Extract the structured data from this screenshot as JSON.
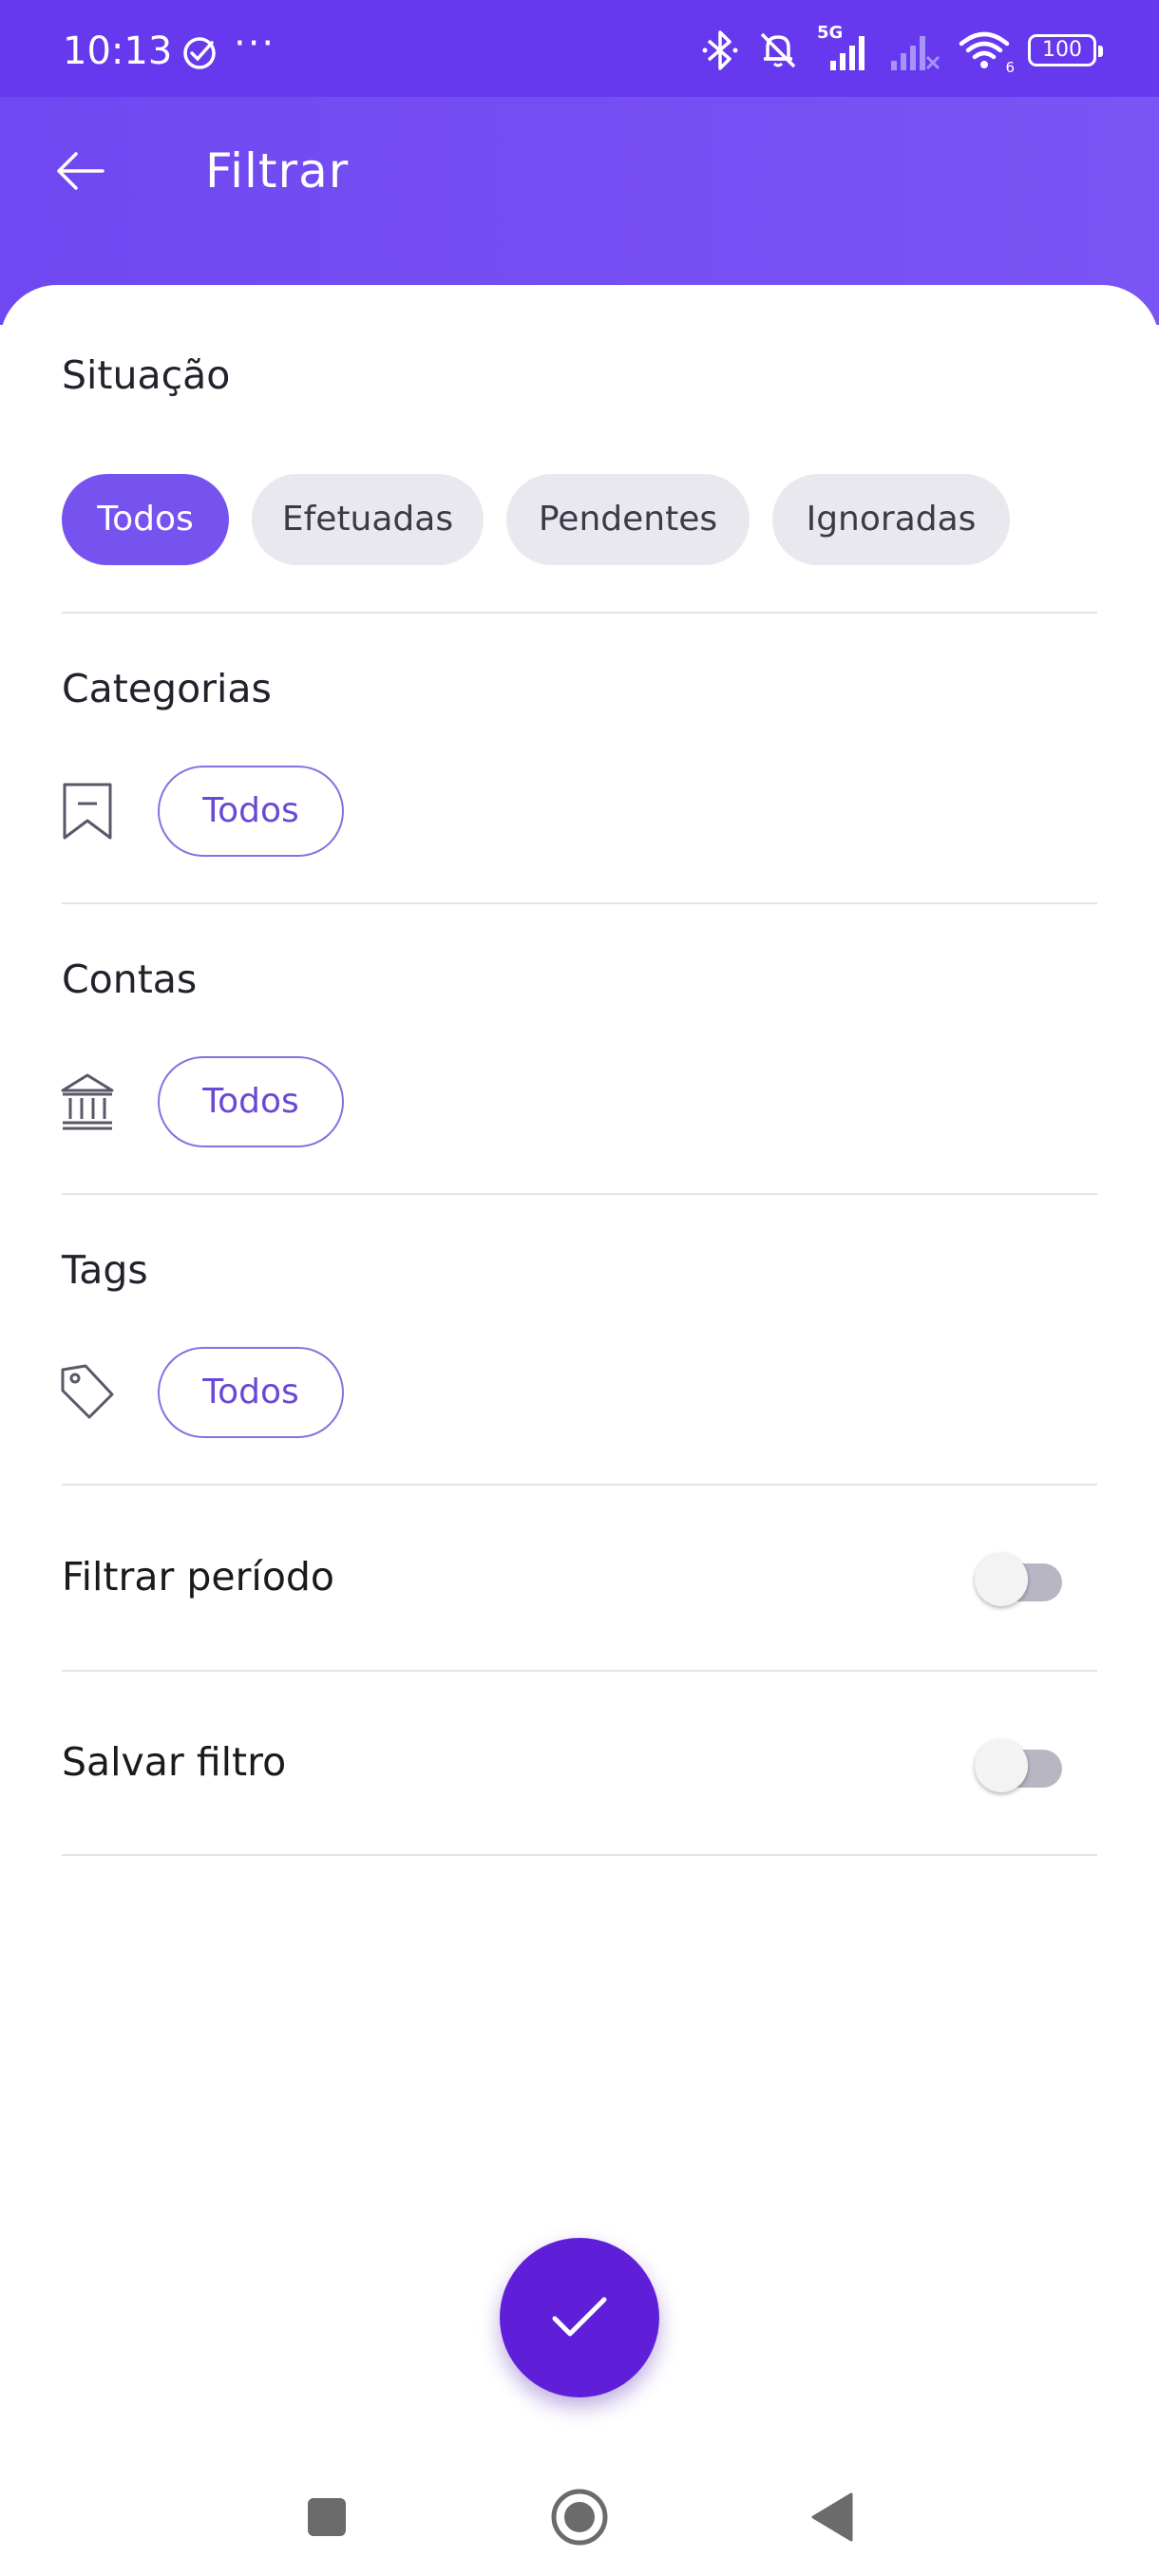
{
  "status_bar": {
    "time": "10:13",
    "network_label": "5G",
    "wifi_label": "6",
    "battery": "100",
    "icons": [
      "check-circle-icon",
      "more-dots-icon",
      "bluetooth-icon",
      "bell-off-icon",
      "signal-icon",
      "signal-off-icon",
      "wifi-icon",
      "battery-icon"
    ]
  },
  "app_bar": {
    "title": "Filtrar",
    "back_icon": "arrow-left-icon",
    "color": "#7048f1"
  },
  "situacao": {
    "title": "Situação",
    "chips": [
      {
        "label": "Todos",
        "selected": true
      },
      {
        "label": "Efetuadas",
        "selected": false
      },
      {
        "label": "Pendentes",
        "selected": false
      },
      {
        "label": "Ignoradas",
        "selected": false
      }
    ]
  },
  "categorias": {
    "title": "Categorias",
    "icon": "bookmark-icon",
    "chip_label": "Todos"
  },
  "contas": {
    "title": "Contas",
    "icon": "bank-icon",
    "chip_label": "Todos"
  },
  "tags": {
    "title": "Tags",
    "icon": "tag-icon",
    "chip_label": "Todos"
  },
  "toggles": {
    "filtrar_periodo": {
      "label": "Filtrar período",
      "on": false
    },
    "salvar_filtro": {
      "label": "Salvar filtro",
      "on": false
    }
  },
  "fab": {
    "icon": "check-icon",
    "color": "#5f1fd8"
  },
  "nav_bar": {
    "icons": [
      "recents-square-icon",
      "home-circle-icon",
      "back-triangle-icon"
    ]
  },
  "colors": {
    "accent": "#7653ef",
    "status_bar": "#6639ee",
    "chip_unselected": "#e9e8ee"
  }
}
